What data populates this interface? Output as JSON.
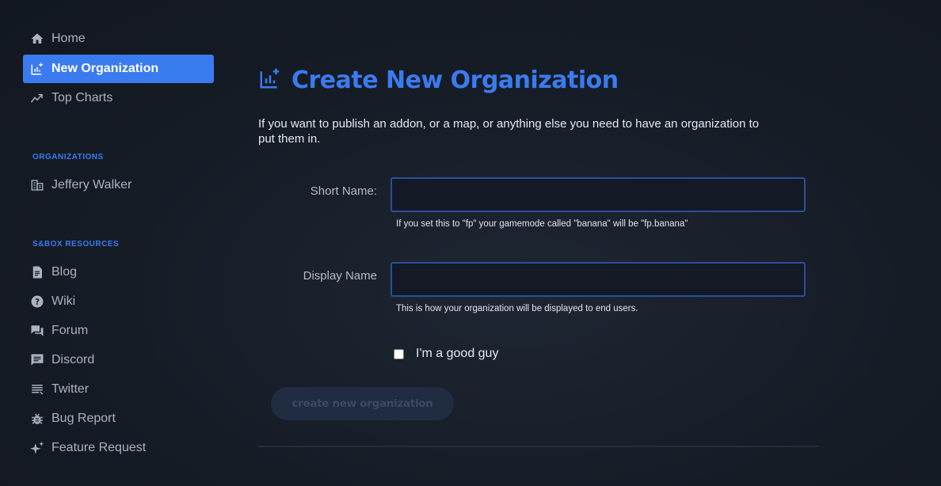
{
  "sidebar": {
    "nav": [
      {
        "label": "Home",
        "icon": "home-icon"
      },
      {
        "label": "New Organization",
        "icon": "new-organization-icon",
        "active": true
      },
      {
        "label": "Top Charts",
        "icon": "trending-icon"
      }
    ],
    "organizations": {
      "heading": "ORGANIZATIONS",
      "items": [
        {
          "label": "Jeffery Walker",
          "icon": "organization-icon"
        }
      ]
    },
    "resources": {
      "heading": "S&BOX RESOURCES",
      "items": [
        {
          "label": "Blog",
          "icon": "article-icon"
        },
        {
          "label": "Wiki",
          "icon": "help-icon"
        },
        {
          "label": "Forum",
          "icon": "forum-icon"
        },
        {
          "label": "Discord",
          "icon": "chat-icon"
        },
        {
          "label": "Twitter",
          "icon": "feed-icon"
        },
        {
          "label": "Bug Report",
          "icon": "bug-icon"
        },
        {
          "label": "Feature Request",
          "icon": "sparkle-icon"
        }
      ]
    }
  },
  "main": {
    "title": "Create New Organization",
    "intro": "If you want to publish an addon, or a map, or anything else you need to have an organization to put them in.",
    "short_name": {
      "label": "Short Name:",
      "value": "",
      "help": "If you set this to \"fp\" your gamemode called \"banana\" will be \"fp.banana\""
    },
    "display_name": {
      "label": "Display Name",
      "value": "",
      "help": "This is how your organization will be displayed to end users."
    },
    "checkbox": {
      "label": "I'm a good guy",
      "checked": false
    },
    "submit_label": "create new organization"
  },
  "colors": {
    "accent": "#3a7bef",
    "background": "#161c26",
    "sidebar_text": "#a9b3c1",
    "input_border": "#2a4f9a",
    "button_disabled": "#1f2c42"
  }
}
